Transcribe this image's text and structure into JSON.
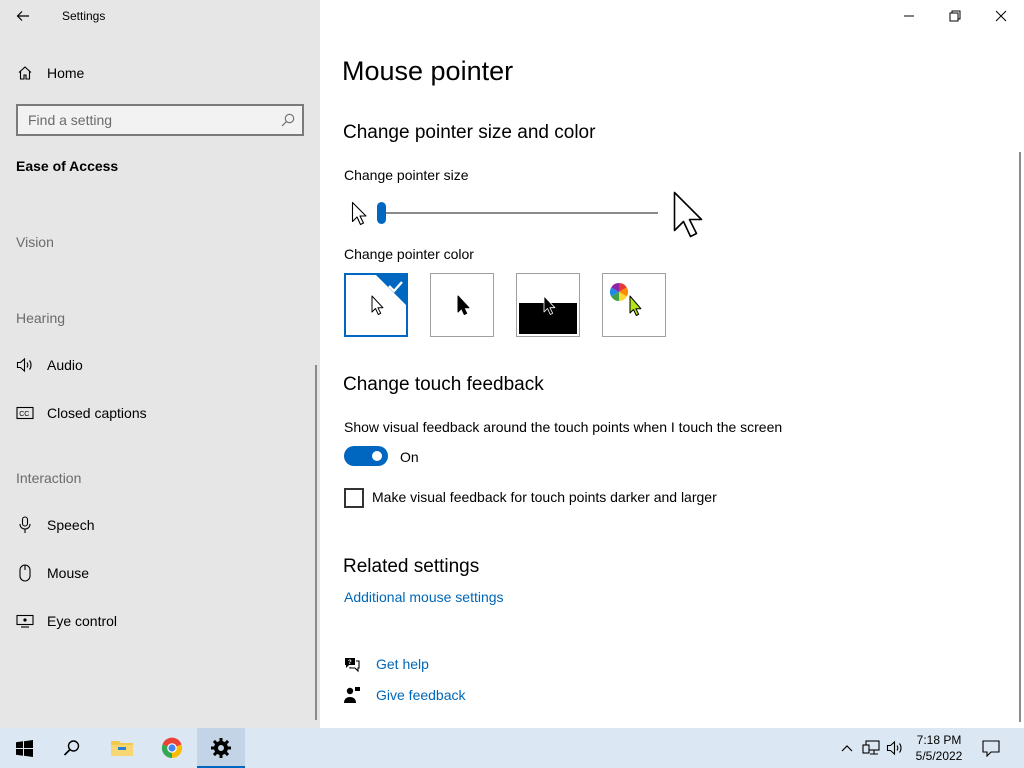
{
  "window": {
    "app_title": "Settings",
    "controls": {
      "minimize": "minimize-icon",
      "restore": "restore-icon",
      "close": "close-icon"
    }
  },
  "sidebar": {
    "home_label": "Home",
    "search_placeholder": "Find a setting",
    "section_title": "Ease of Access",
    "groups": {
      "vision": "Vision",
      "hearing": "Hearing",
      "interaction": "Interaction"
    },
    "items": [
      {
        "label": "Audio",
        "icon": "speaker-icon"
      },
      {
        "label": "Closed captions",
        "icon": "closed-captions-icon"
      },
      {
        "label": "Speech",
        "icon": "microphone-icon"
      },
      {
        "label": "Mouse",
        "icon": "mouse-icon"
      },
      {
        "label": "Eye control",
        "icon": "eye-control-icon"
      }
    ]
  },
  "main": {
    "page_title": "Mouse pointer",
    "pointer_section": {
      "heading": "Change pointer size and color",
      "size_label": "Change pointer size",
      "size_value": 1,
      "size_min": 1,
      "size_max": 15,
      "color_label": "Change pointer color",
      "color_options": [
        "white",
        "black",
        "inverted",
        "custom"
      ],
      "selected_color": "white"
    },
    "touch_section": {
      "heading": "Change touch feedback",
      "feedback_label": "Show visual feedback around the touch points when I touch the screen",
      "toggle_state": "On",
      "darker_label": "Make visual feedback for touch points darker and larger",
      "darker_checked": false
    },
    "related": {
      "heading": "Related settings",
      "link": "Additional mouse settings"
    },
    "help": {
      "get_help": "Get help",
      "give_feedback": "Give feedback"
    }
  },
  "taskbar": {
    "apps": [
      "start-icon",
      "search-icon",
      "file-explorer-icon",
      "chrome-icon",
      "settings-icon"
    ],
    "time": "7:18 PM",
    "date": "5/5/2022"
  },
  "colors": {
    "accent": "#0067c0",
    "link": "#0067b8",
    "sidebar_bg": "#e6e6e6",
    "taskbar_bg": "#dbe7f3"
  }
}
